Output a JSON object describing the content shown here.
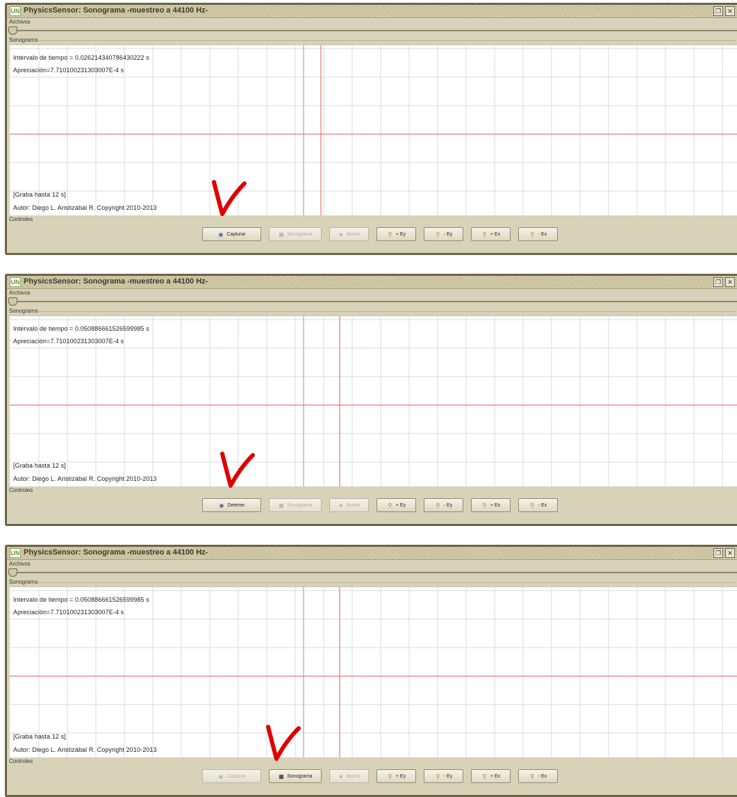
{
  "windows": [
    {
      "title": "PhysicsSensor: Sonograma -muestreo a 44100 Hz-",
      "menu": "Archivos",
      "panel_label": "Sonograma",
      "readout_interval": "Intervalo de tiempo = 0.026214340786430222  s",
      "readout_appreciation": "Apreciación=7.710100231303007E-4 s",
      "note_record": "[Graba hasta 12 s]",
      "author": "Autor:  Diego L. Aristizábal R.   Copyright 2010-2013",
      "controls_label": "Controles",
      "buttons": [
        {
          "label": "Capturar",
          "enabled": true,
          "icon": "record-icon"
        },
        {
          "label": "Sonograma",
          "enabled": false,
          "icon": "sonogram-icon"
        },
        {
          "label": "Borrar",
          "enabled": false,
          "icon": "erase-icon"
        },
        {
          "label": "+ Ey",
          "enabled": true,
          "icon": "zoom-in-icon"
        },
        {
          "label": "- Ey",
          "enabled": true,
          "icon": "zoom-out-icon"
        },
        {
          "label": "+ Ex",
          "enabled": true,
          "icon": "zoom-in-icon"
        },
        {
          "label": "- Ex",
          "enabled": true,
          "icon": "zoom-out-icon"
        }
      ]
    },
    {
      "title": "PhysicsSensor: Sonograma -muestreo a 44100 Hz-",
      "menu": "Archivos",
      "panel_label": "Sonograma",
      "readout_interval": "Intervalo de tiempo = 0.050886661526599985  s",
      "readout_appreciation": "Apreciación=7.710100231303007E-4 s",
      "note_record": "[Graba hasta 12 s]",
      "author": "Autor:  Diego L. Aristizábal R.   Copyright 2010-2013",
      "controls_label": "Controles",
      "buttons": [
        {
          "label": "Detener",
          "enabled": true,
          "icon": "record-icon"
        },
        {
          "label": "Sonograma",
          "enabled": false,
          "icon": "sonogram-icon"
        },
        {
          "label": "Borrar",
          "enabled": false,
          "icon": "erase-icon"
        },
        {
          "label": "+ Ey",
          "enabled": true,
          "icon": "zoom-in-icon"
        },
        {
          "label": "- Ey",
          "enabled": true,
          "icon": "zoom-out-icon"
        },
        {
          "label": "+ Ex",
          "enabled": true,
          "icon": "zoom-in-icon"
        },
        {
          "label": "- Ex",
          "enabled": true,
          "icon": "zoom-out-icon"
        }
      ]
    },
    {
      "title": "PhysicsSensor: Sonograma -muestreo a 44100 Hz-",
      "menu": "Archivos",
      "panel_label": "Sonograma",
      "readout_interval": "Intervalo de tiempo = 0.050886661526599985  s",
      "readout_appreciation": "Apreciación=7.710100231303007E-4 s",
      "note_record": "[Graba hasta 12 s]",
      "author": "Autor:  Diego L. Aristizábal R.   Copyright 2010-2013",
      "controls_label": "Controles",
      "buttons": [
        {
          "label": "Capturar",
          "enabled": false,
          "icon": "record-icon"
        },
        {
          "label": "Sonograma",
          "enabled": true,
          "icon": "sonogram-icon"
        },
        {
          "label": "Borrar",
          "enabled": false,
          "icon": "erase-icon"
        },
        {
          "label": "+ Ey",
          "enabled": true,
          "icon": "zoom-in-icon"
        },
        {
          "label": "- Ey",
          "enabled": true,
          "icon": "zoom-out-icon"
        },
        {
          "label": "+ Ex",
          "enabled": true,
          "icon": "zoom-in-icon"
        },
        {
          "label": "- Ex",
          "enabled": true,
          "icon": "zoom-out-icon"
        }
      ]
    }
  ],
  "colors": {
    "frame": "#6b6446",
    "chrome": "#d8d3b8",
    "grid": "#d9d9e6",
    "axis_red": "#e05a5a",
    "cursor_blue": "#8f8fd8",
    "annotation_arrow": "#e00000"
  }
}
